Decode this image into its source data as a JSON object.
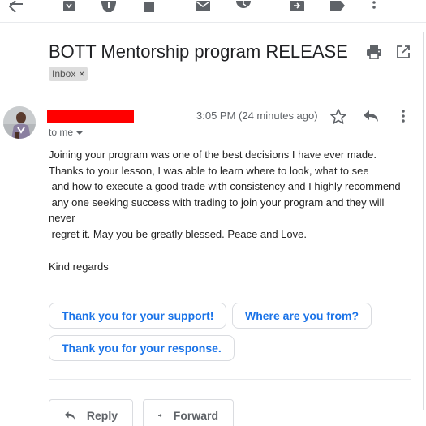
{
  "toolbar": {
    "icons": [
      "back-arrow-icon",
      "archive-icon",
      "report-spam-icon",
      "delete-icon",
      "mark-unread-icon",
      "snooze-icon",
      "move-to-icon",
      "label-icon",
      "more-vert-icon"
    ]
  },
  "email": {
    "subject": "BOTT Mentorship program RELEASE",
    "label": "Inbox",
    "label_remove": "×",
    "time": "3:05 PM (24 minutes ago)",
    "to": "to me",
    "body_lines": [
      "Joining your program was one of the best decisions I have ever made.",
      "Thanks to your lesson, I was able to learn where to look, what to see",
      " and how to execute a good trade with consistency and I highly recommend",
      " any one seeking success with trading to join your program and they will",
      "never",
      " regret it. May you be greatly blessed. Peace and Love."
    ],
    "closing": "Kind regards"
  },
  "smart_replies": [
    "Thank you for your support!",
    "Where are you from?",
    "Thank you for your response."
  ],
  "actions": {
    "reply": "Reply",
    "forward": "Forward"
  },
  "colors": {
    "link_blue": "#1a73e8",
    "icon_gray": "#5f6368",
    "redaction": "#ff0000"
  }
}
